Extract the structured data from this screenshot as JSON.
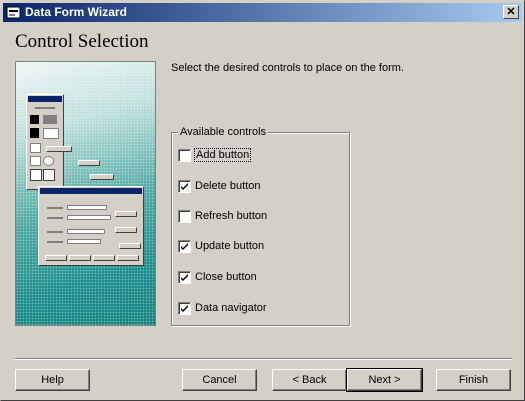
{
  "window": {
    "title": "Data Form Wizard",
    "close_glyph": "✕"
  },
  "page": {
    "heading": "Control Selection",
    "instruction": "Select the desired controls to place on the form."
  },
  "controls": {
    "group_label": "Available controls",
    "items": [
      {
        "label": "Add button",
        "checked": false,
        "focused": true
      },
      {
        "label": "Delete button",
        "checked": true,
        "focused": false
      },
      {
        "label": "Refresh button",
        "checked": false,
        "focused": false
      },
      {
        "label": "Update button",
        "checked": true,
        "focused": false
      },
      {
        "label": "Close button",
        "checked": true,
        "focused": false
      },
      {
        "label": "Data navigator",
        "checked": true,
        "focused": false
      }
    ]
  },
  "buttons": {
    "help": "Help",
    "cancel": "Cancel",
    "back": "< Back",
    "next": "Next >",
    "finish": "Finish"
  },
  "colors": {
    "titlebar_start": "#0a246a",
    "titlebar_end": "#a6caf0",
    "face": "#d4d0c8",
    "illustration_teal": "#1e8f8d"
  },
  "icons": {
    "title": "wizard-app-icon",
    "close": "close-icon"
  }
}
